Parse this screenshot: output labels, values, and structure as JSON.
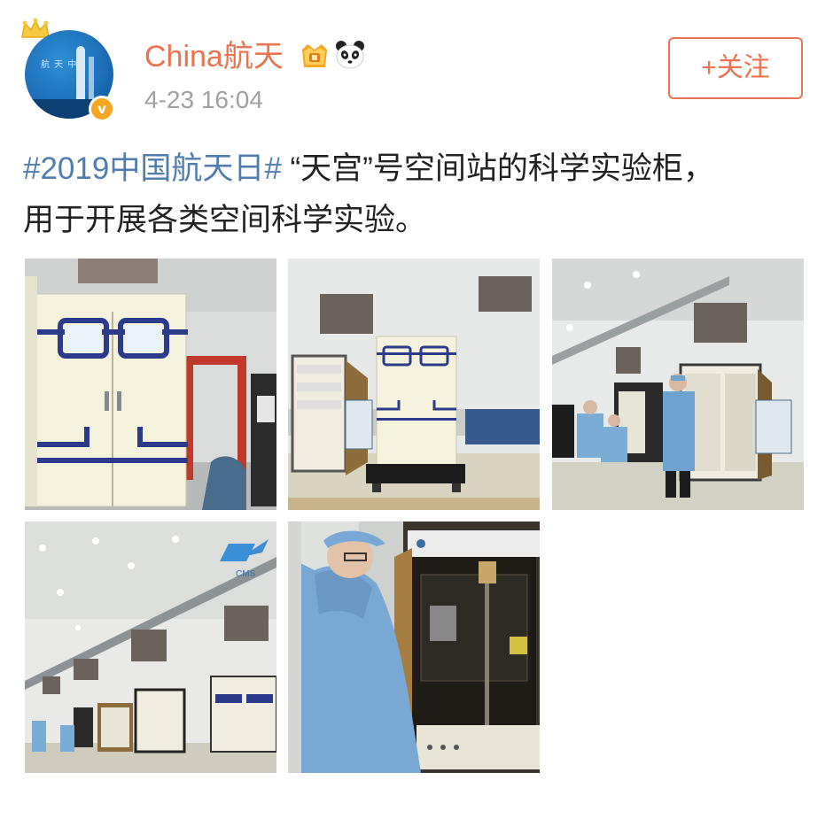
{
  "user": {
    "name": "China航天",
    "timestamp": "4-23 16:04",
    "avatar_icon": "avatar-rocket",
    "badges": [
      "vip-crown-icon",
      "panda-icon",
      "verified-icon"
    ],
    "verified_mark": "v"
  },
  "actions": {
    "follow_label": "+关注"
  },
  "post": {
    "hashtag": "#2019中国航天日#",
    "text_line1": " “天宫”号空间站的科学实验柜，",
    "text_line2": "用于开展各类空间科学实验。"
  },
  "photos": {
    "watermark_text": "CMS"
  },
  "colors": {
    "accent": "#eb7350",
    "link": "#507daf",
    "timestamp": "#a0a0a0"
  }
}
